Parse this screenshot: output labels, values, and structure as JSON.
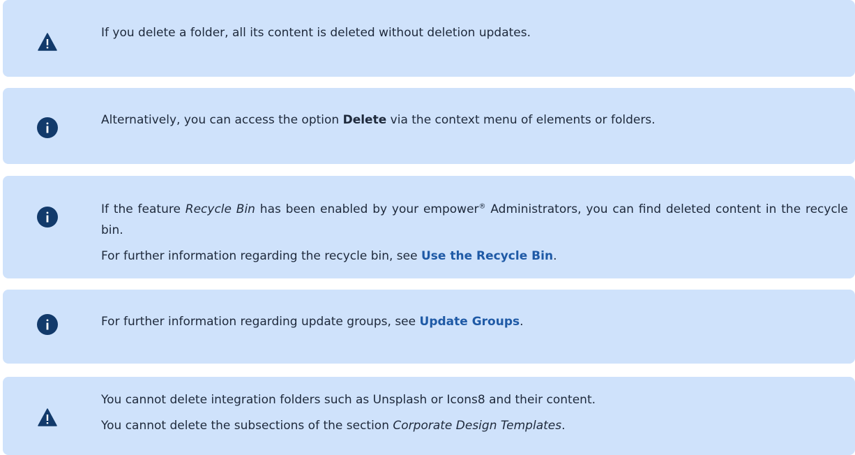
{
  "notes": [
    {
      "type": "warning",
      "icon": "warning-triangle-icon",
      "line1": "If you delete a folder, all its content is deleted without deletion updates."
    },
    {
      "type": "info",
      "icon": "info-circle-icon",
      "prefix": "Alternatively, you can access the option ",
      "bold": "Delete",
      "suffix": " via the context menu of elements or folders."
    },
    {
      "type": "info",
      "icon": "info-circle-icon",
      "p1_prefix": "If the feature ",
      "p1_italic": "Recycle Bin",
      "p1_mid": " has been enabled by your empower",
      "p1_reg": "®",
      "p1_suffix": " Administrators, you can find deleted content in the recycle bin.",
      "p2_prefix": "For further information regarding the recycle bin, see ",
      "p2_link": "Use the Recycle Bin",
      "p2_suffix": "."
    },
    {
      "type": "info",
      "icon": "info-circle-icon",
      "prefix": "For further information regarding update groups, see ",
      "link": "Update Groups",
      "suffix": "."
    },
    {
      "type": "warning",
      "icon": "warning-triangle-icon",
      "p1": "You cannot delete integration folders such as Unsplash or Icons8 and their content.",
      "p2_prefix": "You cannot delete the subsections of the section ",
      "p2_italic": "Corporate Design Templates",
      "p2_suffix": "."
    }
  ],
  "colors": {
    "box_bg": "#cfe2fb",
    "icon_fill": "#123a6b",
    "link": "#1f5aa6"
  }
}
